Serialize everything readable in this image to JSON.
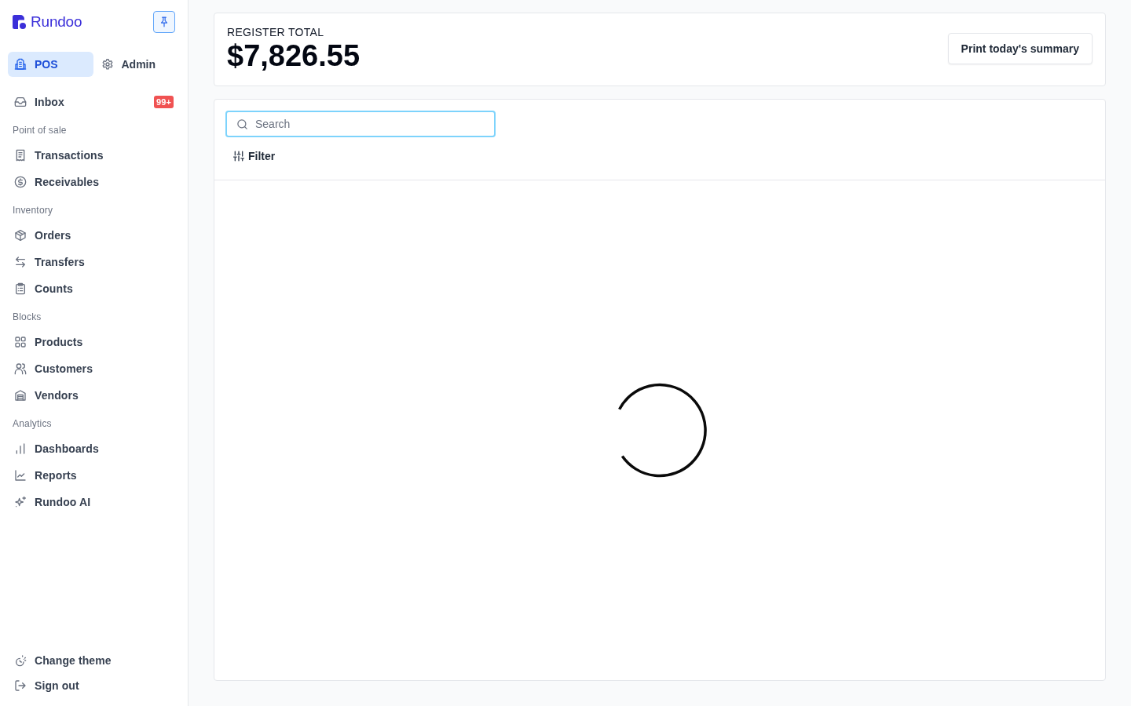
{
  "sidebar": {
    "brand": "Rundoo",
    "pinned": true,
    "modes": [
      {
        "label": "POS",
        "selected": true
      },
      {
        "label": "Admin",
        "selected": false
      }
    ],
    "inbox": {
      "label": "Inbox",
      "badge": "99+"
    },
    "sections": [
      {
        "title": "Point of sale",
        "items": [
          {
            "label": "Transactions"
          },
          {
            "label": "Receivables"
          }
        ]
      },
      {
        "title": "Inventory",
        "items": [
          {
            "label": "Orders"
          },
          {
            "label": "Transfers"
          },
          {
            "label": "Counts"
          }
        ]
      },
      {
        "title": "Blocks",
        "items": [
          {
            "label": "Products"
          },
          {
            "label": "Customers"
          },
          {
            "label": "Vendors"
          }
        ]
      },
      {
        "title": "Analytics",
        "items": [
          {
            "label": "Dashboards"
          },
          {
            "label": "Reports"
          },
          {
            "label": "Rundoo AI"
          }
        ]
      }
    ],
    "footer": [
      {
        "label": "Change theme"
      },
      {
        "label": "Sign out"
      }
    ]
  },
  "register": {
    "label": "REGISTER TOTAL",
    "amount": "$7,826.55",
    "action": "Print today's summary"
  },
  "panel": {
    "search": {
      "placeholder": "Search",
      "focused": true
    },
    "filter": "Filter",
    "loading": true
  }
}
